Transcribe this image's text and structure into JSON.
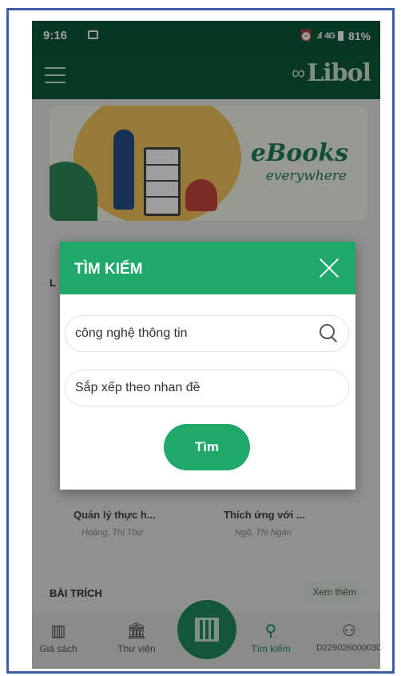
{
  "status_bar": {
    "time": "9:16",
    "network": "4G",
    "battery": "81%"
  },
  "app_bar": {
    "logo_text": "Libol"
  },
  "banner": {
    "line1": "eBooks",
    "line2": "everywhere"
  },
  "background": {
    "section_letter": "L",
    "books": [
      {
        "title": "Quản lý thực h...",
        "author": "Hoàng, Thị Thư"
      },
      {
        "title": "Thích ứng với ...",
        "author": "Ngô, Thị Ngân"
      }
    ],
    "section_bai_trich": "BÀI TRÍCH",
    "see_more": "Xem thêm"
  },
  "modal": {
    "title": "TÌM KIẾM",
    "search_value": "công nghệ thông tin",
    "sort_value": "Sắp xếp theo nhan đề",
    "submit_label": "Tìm"
  },
  "bottom_nav": {
    "items": [
      {
        "label": "Giá sách",
        "icon": "books-icon"
      },
      {
        "label": "Thư viện",
        "icon": "library-icon"
      },
      {
        "label": "Tìm kiếm",
        "icon": "search-icon"
      },
      {
        "label": "D2290260000300",
        "icon": "user-icon"
      }
    ]
  },
  "colors": {
    "primary_dark": "#0a5b3d",
    "accent": "#20a86a",
    "frame_border": "#3d5fa8"
  }
}
